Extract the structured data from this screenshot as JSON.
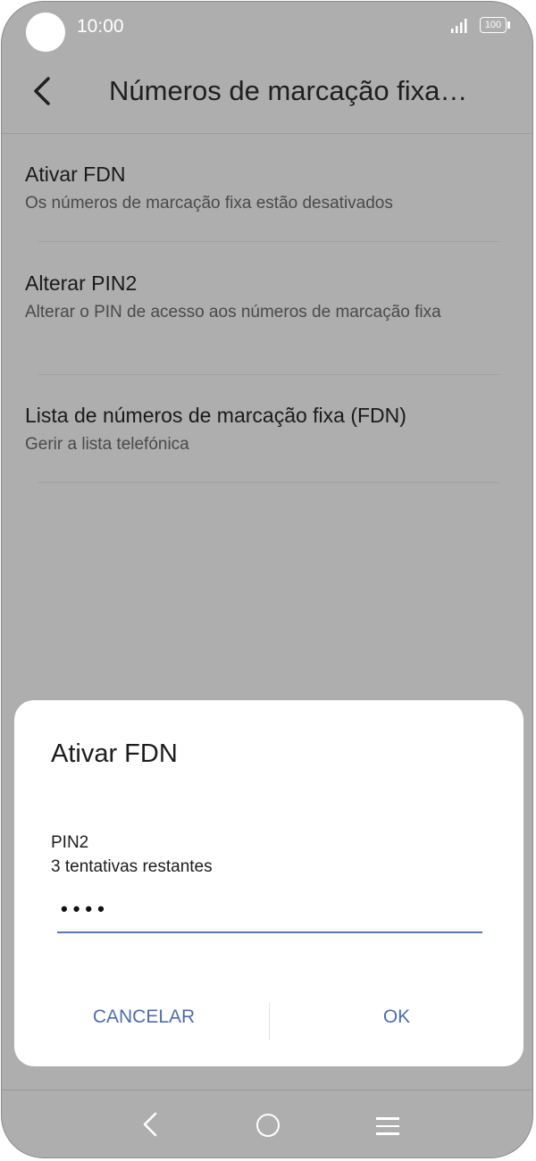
{
  "status_bar": {
    "time": "10:00",
    "battery": "100",
    "icons": [
      "signal-icon",
      "battery-icon"
    ]
  },
  "app_bar": {
    "title": "Números de marcação fixa…",
    "back_icon": "back-arrow-icon"
  },
  "settings": {
    "items": [
      {
        "title": "Ativar FDN",
        "subtitle": "Os números de marcação fixa estão desativados"
      },
      {
        "title": "Alterar PIN2",
        "subtitle": "Alterar o PIN de acesso aos números de marcação fixa"
      },
      {
        "title": "Lista de números de marcação fixa (FDN)",
        "subtitle": "Gerir a lista telefónica"
      }
    ]
  },
  "dialog": {
    "title": "Ativar FDN",
    "label": "PIN2",
    "attempts": "3 tentativas restantes",
    "pin_value": "••••",
    "cancel_label": "CANCELAR",
    "ok_label": "OK"
  },
  "nav_bar": {
    "icons": [
      "nav-back-icon",
      "nav-home-icon",
      "nav-menu-icon"
    ]
  },
  "colors": {
    "scrim": "#aeaeae",
    "accent": "#5874b8",
    "button_text": "#4e6dad",
    "dialog_bg": "#ffffff"
  }
}
